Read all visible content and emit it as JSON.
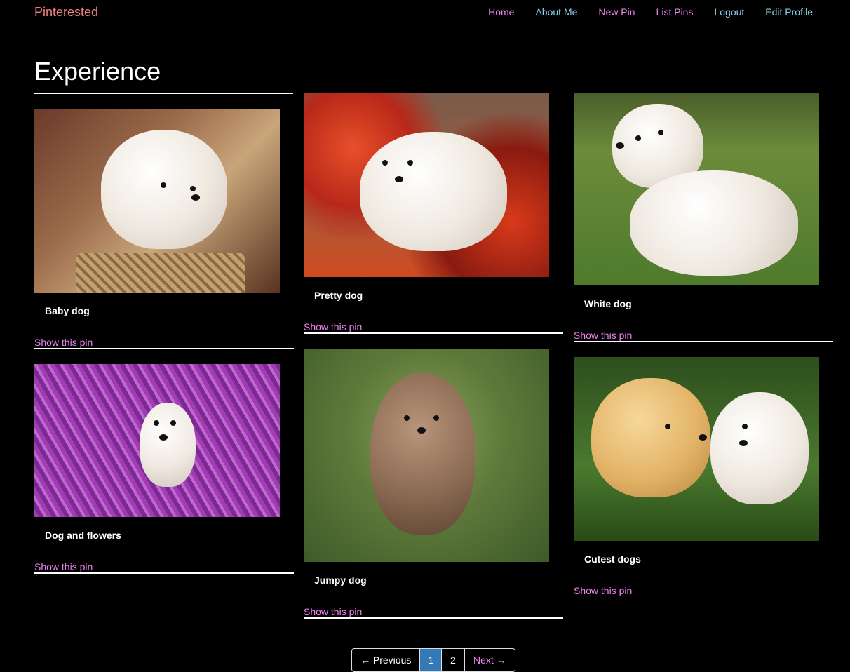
{
  "brand": "Pinterested",
  "nav": [
    {
      "label": "Home",
      "color": "#ee82ee"
    },
    {
      "label": "About Me",
      "color": "#87ceeb"
    },
    {
      "label": "New Pin",
      "color": "#ee82ee"
    },
    {
      "label": "List Pins",
      "color": "#ee82ee"
    },
    {
      "label": "Logout",
      "color": "#87ceeb"
    },
    {
      "label": "Edit Profile",
      "color": "#87ceeb"
    }
  ],
  "page_title": "Experience",
  "pins": [
    {
      "title": "Baby dog",
      "link": "Show this pin"
    },
    {
      "title": "Pretty dog",
      "link": "Show this pin"
    },
    {
      "title": "White dog",
      "link": "Show this pin"
    },
    {
      "title": "Dog and flowers",
      "link": "Show this pin"
    },
    {
      "title": "Jumpy dog",
      "link": "Show this pin"
    },
    {
      "title": "Cutest dogs",
      "link": "Show this pin"
    }
  ],
  "pagination": {
    "previous": "← Previous",
    "pages": [
      "1",
      "2"
    ],
    "current": "1",
    "next": "Next →"
  },
  "colors": {
    "background": "#000000",
    "link": "#ee82ee",
    "active_page": "#337ab7",
    "brand": "#f08080"
  }
}
